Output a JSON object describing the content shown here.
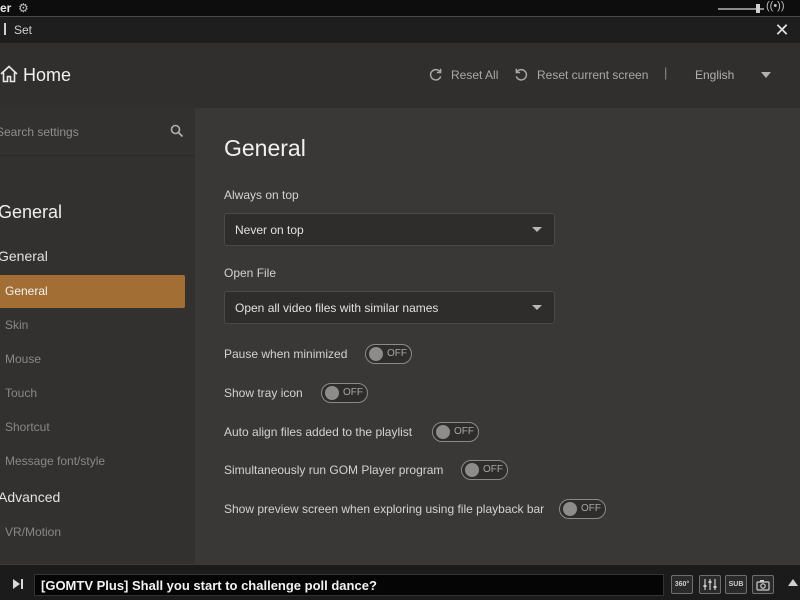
{
  "player": {
    "app_fragment": "er",
    "gear_icon": "gear-icon"
  },
  "dialog": {
    "title": "Set",
    "close_label": "✕"
  },
  "header": {
    "home_label": "Home",
    "reset_all_label": "Reset All",
    "reset_screen_label": "Reset current screen",
    "separator": "|",
    "language": "English"
  },
  "sidebar": {
    "search_placeholder": "Search settings",
    "heading": "General",
    "groups": [
      {
        "label": "General"
      },
      {
        "label": "Advanced"
      }
    ],
    "items": [
      {
        "label": "General",
        "active": true
      },
      {
        "label": "Skin",
        "active": false
      },
      {
        "label": "Mouse",
        "active": false
      },
      {
        "label": "Touch",
        "active": false
      },
      {
        "label": "Shortcut",
        "active": false
      },
      {
        "label": "Message font/style",
        "active": false
      },
      {
        "label": "VR/Motion",
        "active": false
      }
    ],
    "accent_color": "#a36e33"
  },
  "main": {
    "title": "General",
    "always_on_top": {
      "label": "Always on top",
      "value": "Never on top"
    },
    "open_file": {
      "label": "Open File",
      "value": "Open all video files with similar names"
    },
    "options": [
      {
        "label": "Pause when minimized",
        "state": "OFF"
      },
      {
        "label": "Show tray icon",
        "state": "OFF"
      },
      {
        "label": "Auto align files added to the playlist",
        "state": "OFF"
      },
      {
        "label": "Simultaneously run GOM Player program",
        "state": "OFF"
      },
      {
        "label": "Show preview screen when exploring using file playback bar",
        "state": "OFF"
      }
    ]
  },
  "bottom": {
    "ticker": "[GOMTV Plus] Shall you start to challenge poll dance?",
    "btn_360": "360°",
    "btn_sub": "SUB"
  }
}
